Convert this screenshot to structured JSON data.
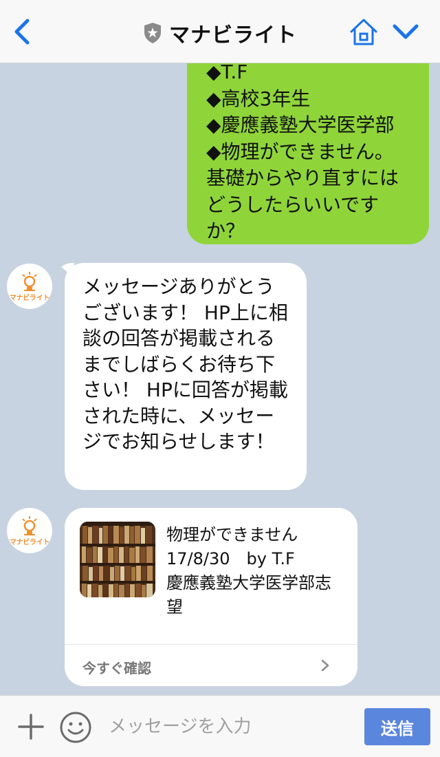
{
  "header": {
    "title": "マナビライト",
    "back_icon": "chevron-left-icon",
    "home_icon": "home-icon",
    "menu_icon": "chevron-down-icon",
    "accent_color": "#1a74e8"
  },
  "messages": {
    "outgoing": {
      "text": "◆T.F\n◆高校3年生\n◆慶應義塾大学医学部\n◆物理ができません。\n基礎からやり直すには\nどうしたらいいです\nか？",
      "color": "#8fd53a"
    },
    "incoming_1": {
      "avatar_label": "マナビライト",
      "text": "メッセージありがとうございます！ HP上に相談の回答が掲載されるまでしばらくお待ち下さい！ HPに回答が掲載された時に、メッセージでお知らせします！"
    },
    "incoming_card": {
      "avatar_label": "マナビライト",
      "title": "物理ができません",
      "meta": "17/8/30　by T.F",
      "subtitle": "慶應義塾大学医学部志望",
      "link_label": "今すぐ確認"
    }
  },
  "input_bar": {
    "placeholder": "メッセージを入力",
    "send_label": "送信",
    "send_color": "#5b86dd"
  }
}
